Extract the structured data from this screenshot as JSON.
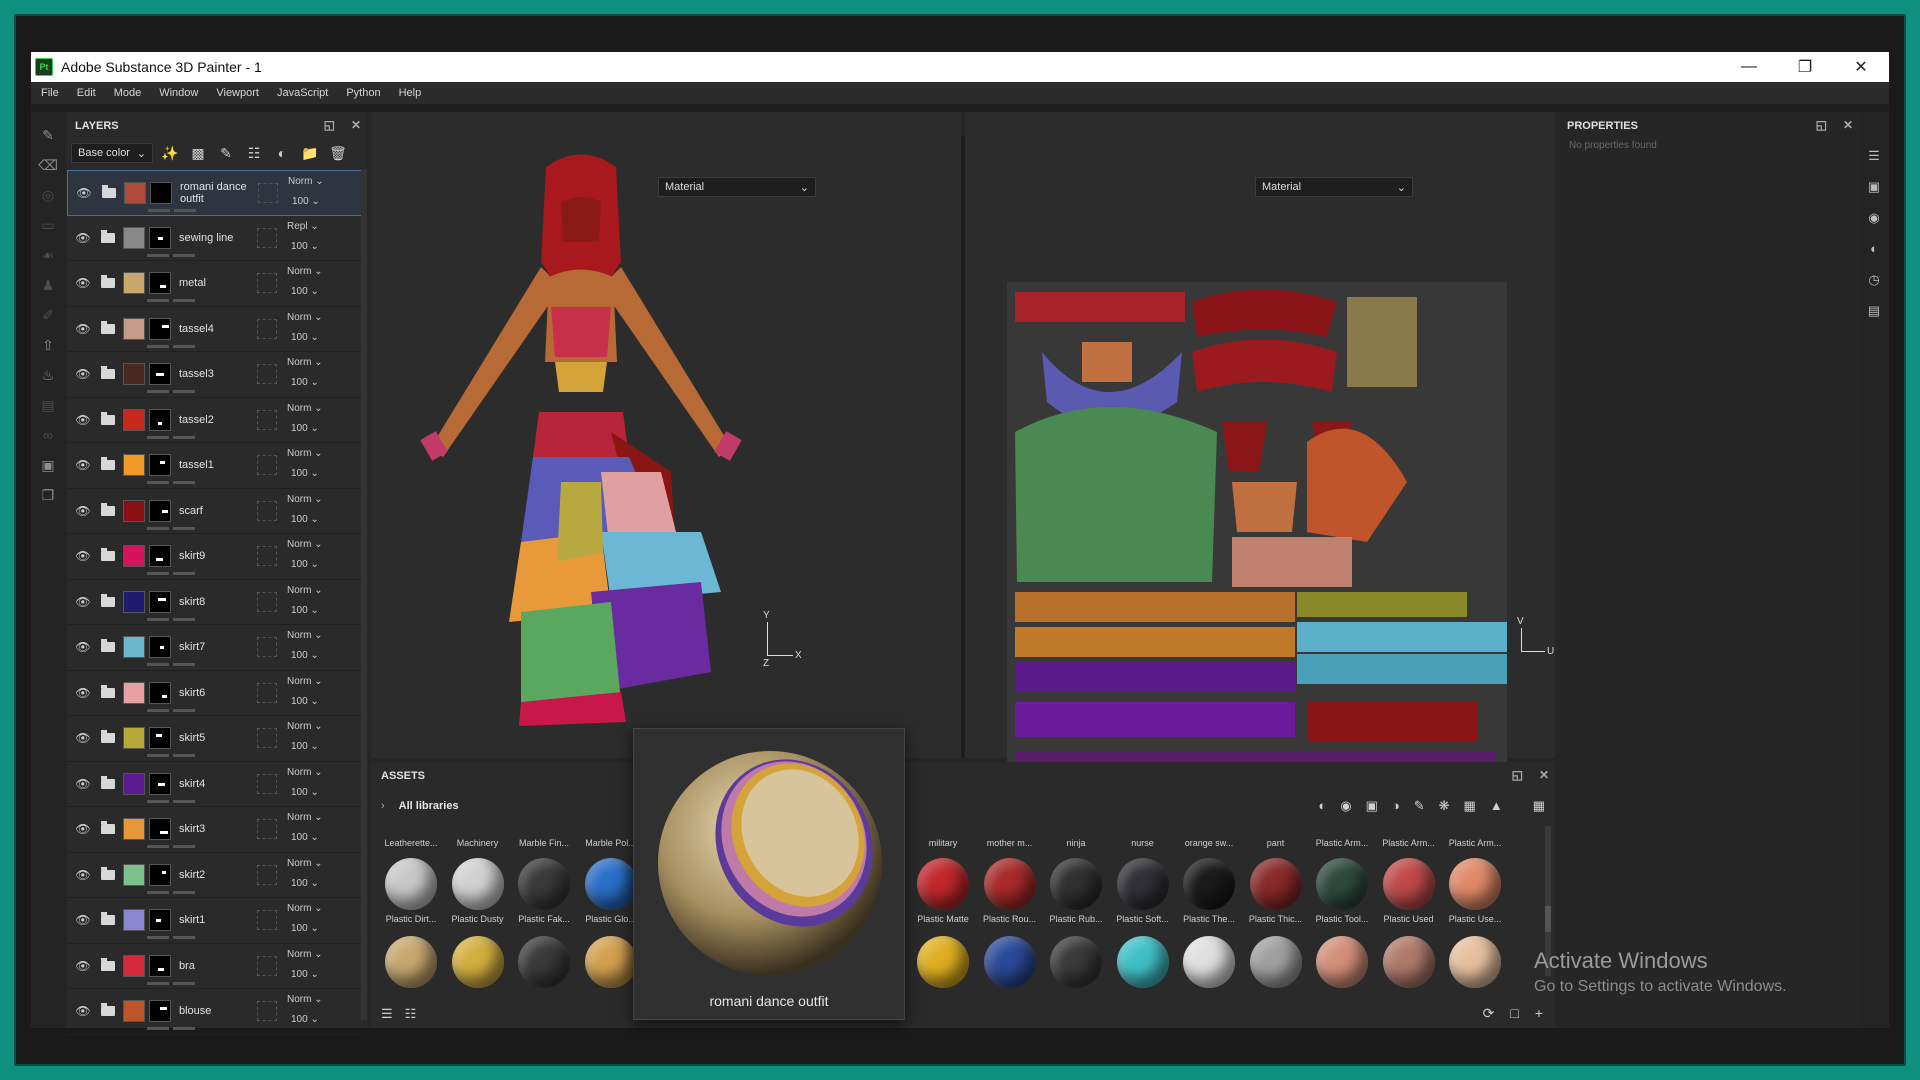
{
  "window": {
    "app_icon": "Pt",
    "title": "Adobe Substance 3D Painter - 1",
    "controls": [
      "minimize-icon",
      "restore-icon",
      "close-icon"
    ]
  },
  "menu": [
    "File",
    "Edit",
    "Mode",
    "Window",
    "Viewport",
    "JavaScript",
    "Python",
    "Help"
  ],
  "layers_panel": {
    "title": "LAYERS",
    "channel": "Base color",
    "layers": [
      {
        "name": "romani dance outfit",
        "blend": "Norm",
        "opacity": "100",
        "color": "#b04a3a",
        "selected": true,
        "group": true
      },
      {
        "name": "sewing line",
        "blend": "Repl",
        "opacity": "100",
        "color": "#888888"
      },
      {
        "name": "metal",
        "blend": "Norm",
        "opacity": "100",
        "color": "#c9a66b"
      },
      {
        "name": "tassel4",
        "blend": "Norm",
        "opacity": "100",
        "color": "#c49a88"
      },
      {
        "name": "tassel3",
        "blend": "Norm",
        "opacity": "100",
        "color": "#4a2a20"
      },
      {
        "name": "tassel2",
        "blend": "Norm",
        "opacity": "100",
        "color": "#c7281e"
      },
      {
        "name": "tassel1",
        "blend": "Norm",
        "opacity": "100",
        "color": "#f09a2a"
      },
      {
        "name": "scarf",
        "blend": "Norm",
        "opacity": "100",
        "color": "#8a0f12"
      },
      {
        "name": "skirt9",
        "blend": "Norm",
        "opacity": "100",
        "color": "#d4145a"
      },
      {
        "name": "skirt8",
        "blend": "Norm",
        "opacity": "100",
        "color": "#221a6e"
      },
      {
        "name": "skirt7",
        "blend": "Norm",
        "opacity": "100",
        "color": "#6ab8cc"
      },
      {
        "name": "skirt6",
        "blend": "Norm",
        "opacity": "100",
        "color": "#e8a0a0"
      },
      {
        "name": "skirt5",
        "blend": "Norm",
        "opacity": "100",
        "color": "#b8a83a"
      },
      {
        "name": "skirt4",
        "blend": "Norm",
        "opacity": "100",
        "color": "#5a1a90"
      },
      {
        "name": "skirt3",
        "blend": "Norm",
        "opacity": "100",
        "color": "#e8963a"
      },
      {
        "name": "skirt2",
        "blend": "Norm",
        "opacity": "100",
        "color": "#7cc08a"
      },
      {
        "name": "skirt1",
        "blend": "Norm",
        "opacity": "100",
        "color": "#8a86d0"
      },
      {
        "name": "bra",
        "blend": "Norm",
        "opacity": "100",
        "color": "#d4283c"
      },
      {
        "name": "blouse",
        "blend": "Norm",
        "opacity": "100",
        "color": "#c0542a"
      }
    ]
  },
  "viewport3d": {
    "mode": "Material",
    "axes": {
      "y": "Y",
      "x": "X",
      "z": "Z"
    }
  },
  "viewport2d": {
    "mode": "Material",
    "axes": {
      "v": "V",
      "u": "U"
    }
  },
  "properties": {
    "title": "PROPERTIES",
    "empty_text": "No properties found"
  },
  "assets": {
    "title": "ASSETS",
    "library": "All libraries",
    "row1": [
      "Leatherette...",
      "Machinery",
      "Marble Fin...",
      "Marble Pol...",
      "",
      "",
      "",
      "",
      "military",
      "mother m...",
      "ninja",
      "nurse",
      "orange sw...",
      "pant",
      "Plastic Arm...",
      "Plastic Arm...",
      "Plastic Arm..."
    ],
    "row2": [
      {
        "label": "Plastic Dirt...",
        "color": "#c8c8c8"
      },
      {
        "label": "Plastic Dusty",
        "color": "#d2d2d2"
      },
      {
        "label": "Plastic Fak...",
        "color": "#3a3a3a"
      },
      {
        "label": "Plastic Glo...",
        "color": "#2a6fc8"
      },
      {
        "label": "",
        "color": "#2a2a2a"
      },
      {
        "label": "",
        "color": "#2a2a2a"
      },
      {
        "label": "",
        "color": "#2a2a2a"
      },
      {
        "label": "",
        "color": "#2a2a2a"
      },
      {
        "label": "Plastic Matte",
        "color": "#c0282c"
      },
      {
        "label": "Plastic Rou...",
        "color": "#a82a2a"
      },
      {
        "label": "Plastic Rub...",
        "color": "#303030"
      },
      {
        "label": "Plastic Soft...",
        "color": "#303036"
      },
      {
        "label": "Plastic The...",
        "color": "#1a1a1a"
      },
      {
        "label": "Plastic Thic...",
        "color": "#8a2a2a"
      },
      {
        "label": "Plastic Tool...",
        "color": "#2e4a3e"
      },
      {
        "label": "Plastic Used",
        "color": "#c04a4a"
      },
      {
        "label": "Plastic Use...",
        "color": "#e08a6a"
      }
    ],
    "row3_colors": [
      "#c8a870",
      "#d4b040",
      "#3a3a3a",
      "#d4a050",
      "#2a2a2a",
      "#2a2a2a",
      "#2a2a2a",
      "#8a2a2a",
      "#e0b020",
      "#2a4a9a",
      "#3a3a3a",
      "#40c0c8",
      "#e0e0e0",
      "#a0a0a0",
      "#d4907a",
      "#b07a6a",
      "#e8c0a0"
    ]
  },
  "preview": {
    "label": "romani dance outfit"
  },
  "watermark": {
    "line1": "Activate Windows",
    "line2": "Go to Settings to activate Windows."
  }
}
